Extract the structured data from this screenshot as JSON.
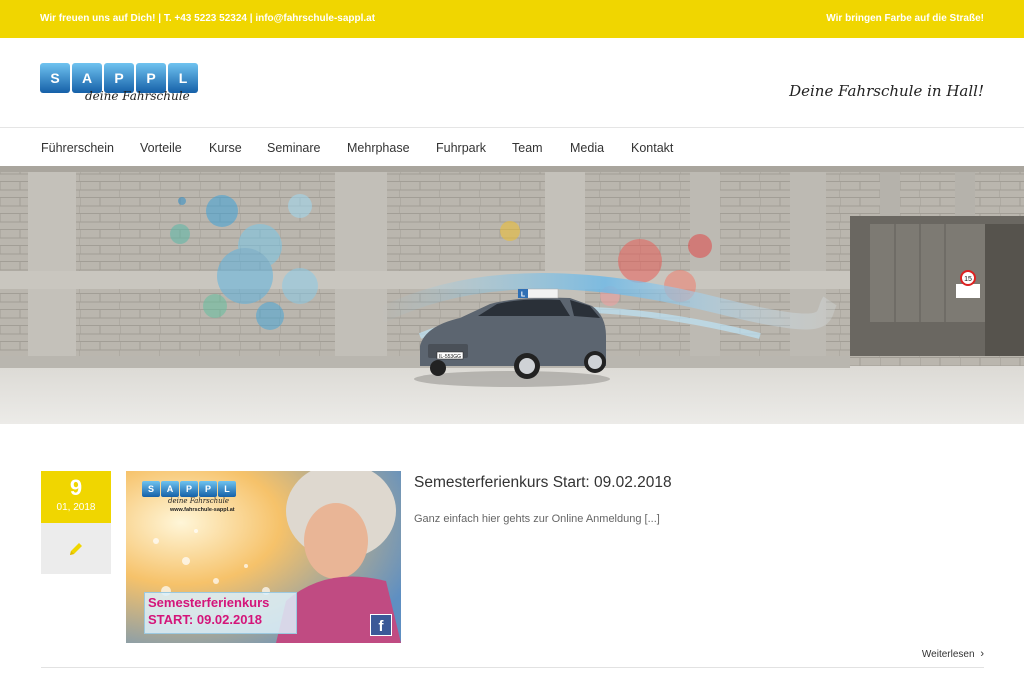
{
  "topbar": {
    "contact": "Wir freuen uns auf Dich! | T. +43 5223 52324  |  info@fahrschule-sappl.at",
    "tagline": "Wir bringen Farbe auf die Straße!"
  },
  "header": {
    "logo_letters": [
      "S",
      "A",
      "P",
      "P",
      "L"
    ],
    "logo_sub": "deine Fahrschule",
    "slogan": "Deine Fahrschule in Hall!"
  },
  "nav": {
    "items": [
      "Führerschein",
      "Vorteile",
      "Kurse",
      "Seminare",
      "Mehrphase",
      "Fuhrpark",
      "Team",
      "Media",
      "Kontakt"
    ],
    "search_icon": "search-icon"
  },
  "hero": {
    "sign_speed": "15",
    "car_roof_sign": "L",
    "plate": "IL-553GG"
  },
  "post": {
    "day": "9",
    "month_year": "01, 2018",
    "type_icon": "pencil-icon",
    "thumb": {
      "logo_letters": [
        "S",
        "A",
        "P",
        "P",
        "L"
      ],
      "logo_sub": "deine Fahrschule",
      "url": "www.fahrschule-sappl.at",
      "line1": "Semesterferienkurs",
      "line2": "START: 09.02.2018",
      "social_icon": "facebook-icon"
    },
    "title": "Semesterferienkurs Start: 09.02.2018",
    "excerpt": "Ganz einfach hier gehts zur Online Anmeldung [...]",
    "read_more": "Weiterlesen"
  },
  "colors": {
    "accent_yellow": "#f0d600",
    "logo_blue": "#1560a8"
  }
}
